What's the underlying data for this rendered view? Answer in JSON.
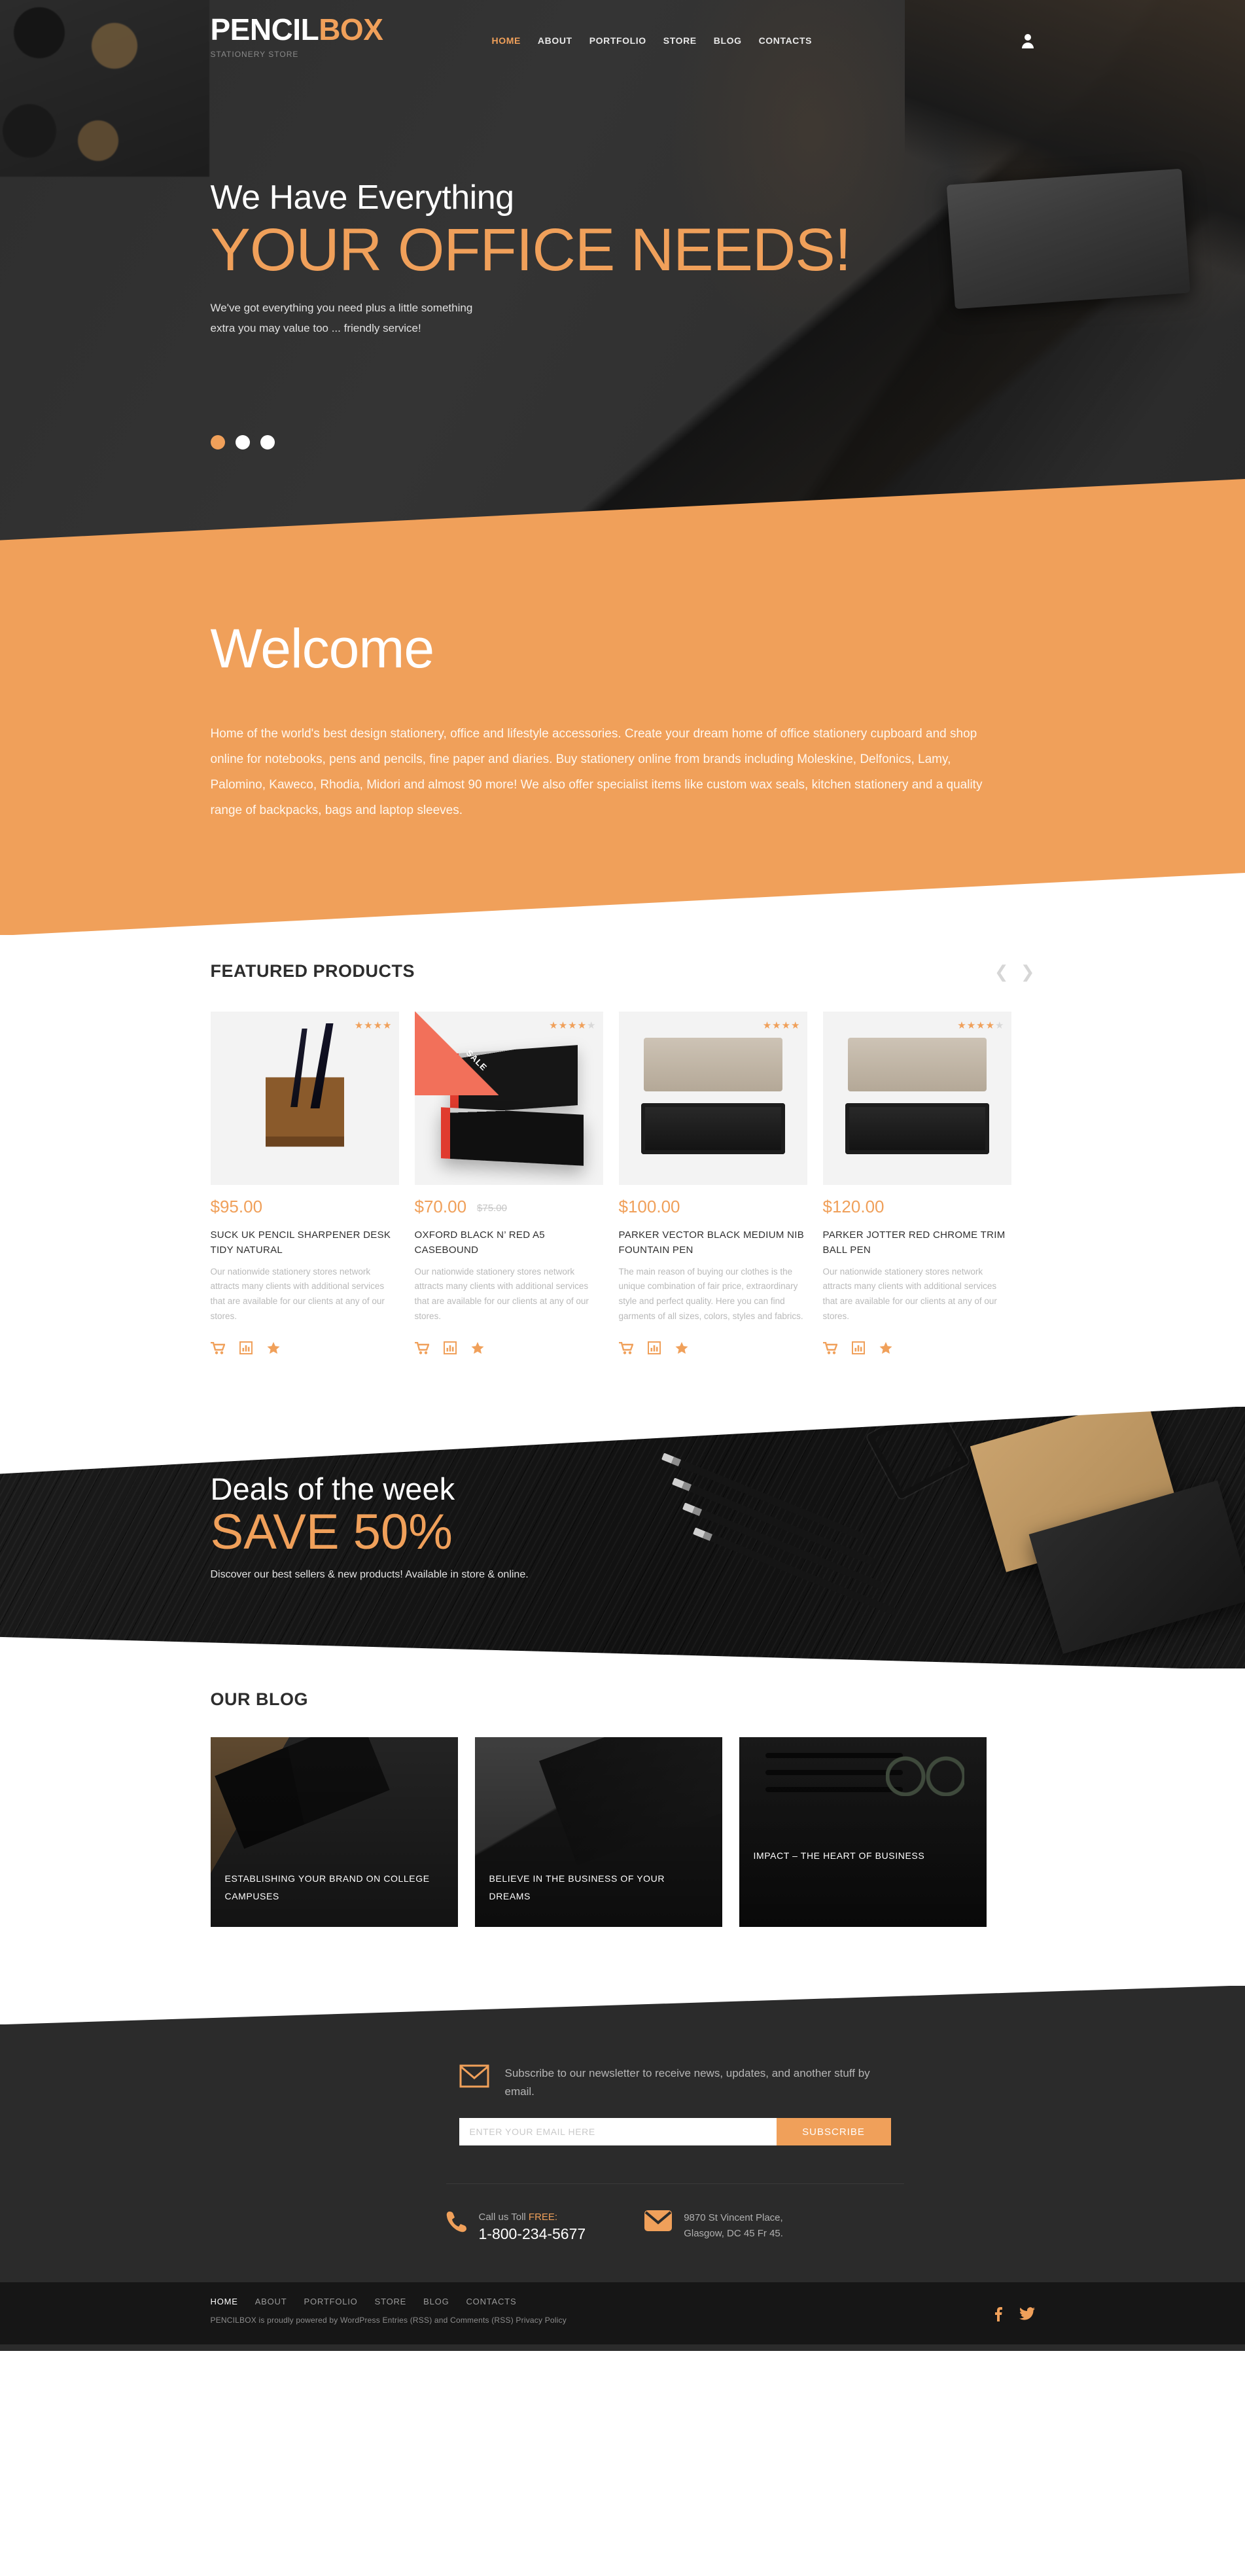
{
  "brand": {
    "name_dark": "PENCIL",
    "name_accent": "BOX",
    "tagline": "STATIONERY STORE"
  },
  "colors": {
    "accent": "#f0a05a",
    "dark": "#2b2b2b",
    "darker": "#161616",
    "sale": "#f2705a"
  },
  "nav": {
    "items": [
      {
        "label": "HOME",
        "active": true
      },
      {
        "label": "ABOUT",
        "active": false
      },
      {
        "label": "PORTFOLIO",
        "active": false
      },
      {
        "label": "STORE",
        "active": false
      },
      {
        "label": "BLOG",
        "active": false
      },
      {
        "label": "CONTACTS",
        "active": false
      }
    ],
    "account_icon": "user-icon"
  },
  "hero": {
    "line1": "We Have Everything",
    "line2": "YOUR OFFICE NEEDS!",
    "sub_line1": "We've got everything you need plus a little something",
    "sub_line2": "extra you may value too ... friendly service!",
    "slides": [
      {
        "active": true
      },
      {
        "active": false
      },
      {
        "active": false
      }
    ]
  },
  "welcome": {
    "title": "Welcome",
    "text": "Home of the world's best design stationery, office and lifestyle accessories. Create your dream home of office stationery cupboard and shop online for notebooks, pens and pencils, fine paper and diaries.  Buy stationery online from brands including Moleskine, Delfonics, Lamy, Palomino, Kaweco, Rhodia, Midori and almost 90 more! We also offer specialist items like custom wax seals, kitchen stationery and a quality range of backpacks, bags and laptop sleeves."
  },
  "featured": {
    "title": "FEATURED PRODUCTS",
    "prev_icon": "chevron-left-icon",
    "next_icon": "chevron-right-icon",
    "products": [
      {
        "price": "$95.00",
        "old_price": "",
        "name": "SUCK UK PENCIL SHARPENER DESK TIDY NATURAL",
        "desc": "Our nationwide stationery stores network attracts many clients with additional services that are available for our clients at any of our stores.",
        "rating": 4,
        "sale": false,
        "actions": [
          "cart-icon",
          "compare-icon",
          "wishlist-icon"
        ]
      },
      {
        "price": "$70.00",
        "old_price": "$75.00",
        "name": "OXFORD BLACK N’ RED A5 CASEBOUND",
        "desc": "Our nationwide stationery stores network attracts many clients with additional services that are available for our clients at any of our stores.",
        "rating": 4,
        "sale": true,
        "sale_label": "SALE",
        "actions": [
          "cart-icon",
          "compare-icon",
          "wishlist-icon"
        ]
      },
      {
        "price": "$100.00",
        "old_price": "",
        "name": "PARKER VECTOR BLACK MEDIUM NIB FOUNTAIN PEN",
        "desc": "The main reason of buying our clothes is the unique combination of fair price, extraordinary style and perfect quality. Here you can find garments of all sizes, colors, styles and fabrics.",
        "rating": 4,
        "sale": false,
        "actions": [
          "cart-icon",
          "compare-icon",
          "wishlist-icon"
        ]
      },
      {
        "price": "$120.00",
        "old_price": "",
        "name": "PARKER JOTTER RED CHROME TRIM BALL PEN",
        "desc": "Our nationwide stationery stores network attracts many clients with additional services that are available for our clients at any of our stores.",
        "rating": 4,
        "sale": false,
        "actions": [
          "cart-icon",
          "compare-icon",
          "wishlist-icon"
        ]
      }
    ]
  },
  "deals": {
    "line1": "Deals of the week",
    "line2": "SAVE 50%",
    "sub": "Discover our best sellers & new products! Available in store & online."
  },
  "blog": {
    "title": "OUR BLOG",
    "posts": [
      {
        "title": "ESTABLISHING YOUR BRAND ON COLLEGE CAMPUSES"
      },
      {
        "title": "BELIEVE IN THE BUSINESS OF YOUR DREAMS"
      },
      {
        "title": "IMPACT – THE HEART OF BUSINESS"
      }
    ]
  },
  "newsletter": {
    "icon": "envelope-outline-icon",
    "text": "Subscribe to our newsletter to receive news, updates, and another stuff by email.",
    "placeholder": "ENTER YOUR EMAIL HERE",
    "value": "",
    "button": "SUBSCRIBE"
  },
  "contacts": {
    "phone": {
      "icon": "phone-icon",
      "label_plain": "Call us Toll ",
      "label_accent": "FREE:",
      "value": "1-800-234-5677"
    },
    "address": {
      "icon": "envelope-filled-icon",
      "line1": "9870 St Vincent Place,",
      "line2": "Glasgow, DC 45 Fr 45."
    }
  },
  "footer": {
    "nav": [
      {
        "label": "HOME",
        "active": true
      },
      {
        "label": "ABOUT",
        "active": false
      },
      {
        "label": "PORTFOLIO",
        "active": false
      },
      {
        "label": "STORE",
        "active": false
      },
      {
        "label": "BLOG",
        "active": false
      },
      {
        "label": "CONTACTS",
        "active": false
      }
    ],
    "copyright": "PENCILBOX is proudly powered by WordPress Entries (RSS) and Comments (RSS) Privacy Policy",
    "social": [
      "facebook-icon",
      "twitter-icon"
    ]
  }
}
